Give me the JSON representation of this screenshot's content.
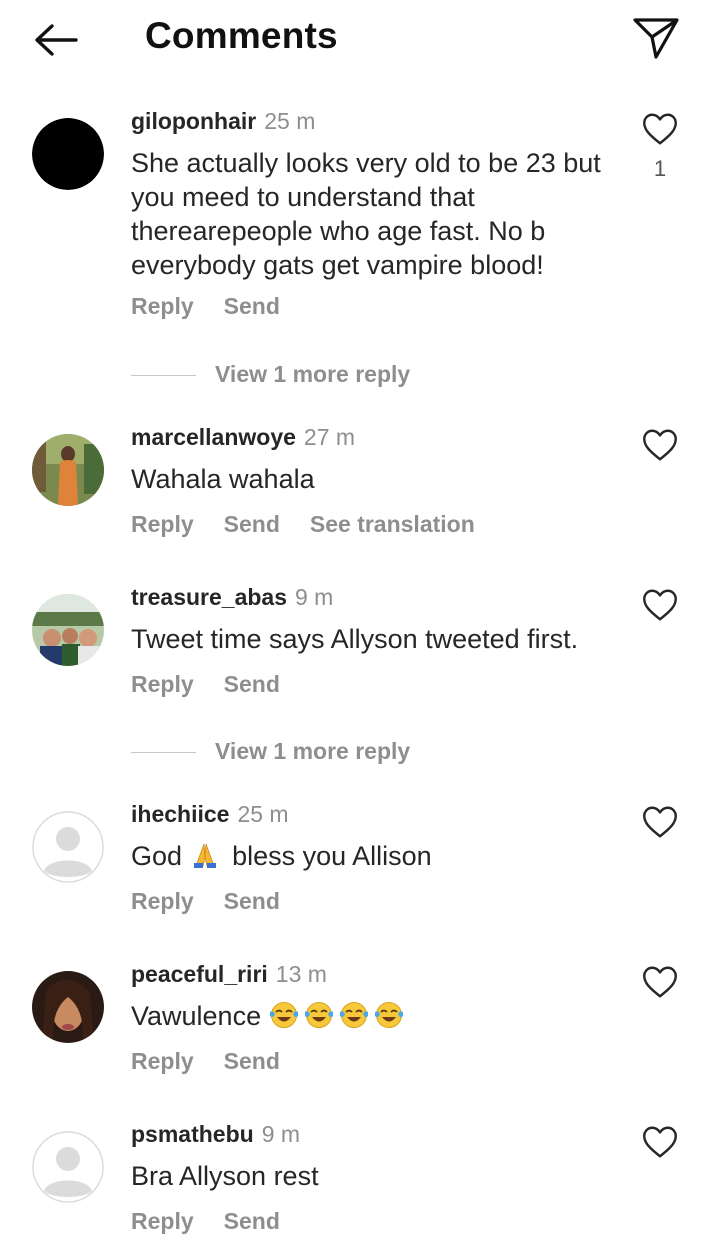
{
  "header": {
    "title": "Comments",
    "back_icon": "arrow-left-icon",
    "send_icon": "paper-plane-icon"
  },
  "colors": {
    "meta_gray": "#8e8e8e",
    "text": "#262626",
    "divider": "#c7c7c7"
  },
  "comments": [
    {
      "username": "giloponhair",
      "time": "25 m",
      "text": "She actually looks very old to be 23 but you meed to understand that therearepeople who age fast. No b everybody gats get vampire blood!",
      "reply": "Reply",
      "send": "Send",
      "likes": "1",
      "avatar": "black-circle-avatar",
      "more_replies": "View 1 more reply"
    },
    {
      "username": "marcellanwoye",
      "time": "27 m",
      "text": "Wahala wahala",
      "reply": "Reply",
      "send": "Send",
      "translate": "See translation",
      "avatar": "photo-avatar"
    },
    {
      "username": "treasure_abas",
      "time": "9 m",
      "text": "Tweet time says Allyson tweeted first.",
      "reply": "Reply",
      "send": "Send",
      "avatar": "photo-avatar",
      "more_replies": "View 1 more reply"
    },
    {
      "username": "ihechiice",
      "time": "25 m",
      "text_before": "God",
      "text_after": "bless you Allison",
      "emoji": "folded-hands-icon",
      "reply": "Reply",
      "send": "Send",
      "avatar": "default-avatar"
    },
    {
      "username": "peaceful_riri",
      "time": "13 m",
      "text": "Vawulence",
      "emoji": "tears-of-joy-icon",
      "emoji_count": 4,
      "reply": "Reply",
      "send": "Send",
      "avatar": "photo-avatar"
    },
    {
      "username": "psmathebu",
      "time": "9 m",
      "text": "Bra Allyson rest",
      "reply": "Reply",
      "send": "Send",
      "avatar": "default-avatar"
    }
  ]
}
